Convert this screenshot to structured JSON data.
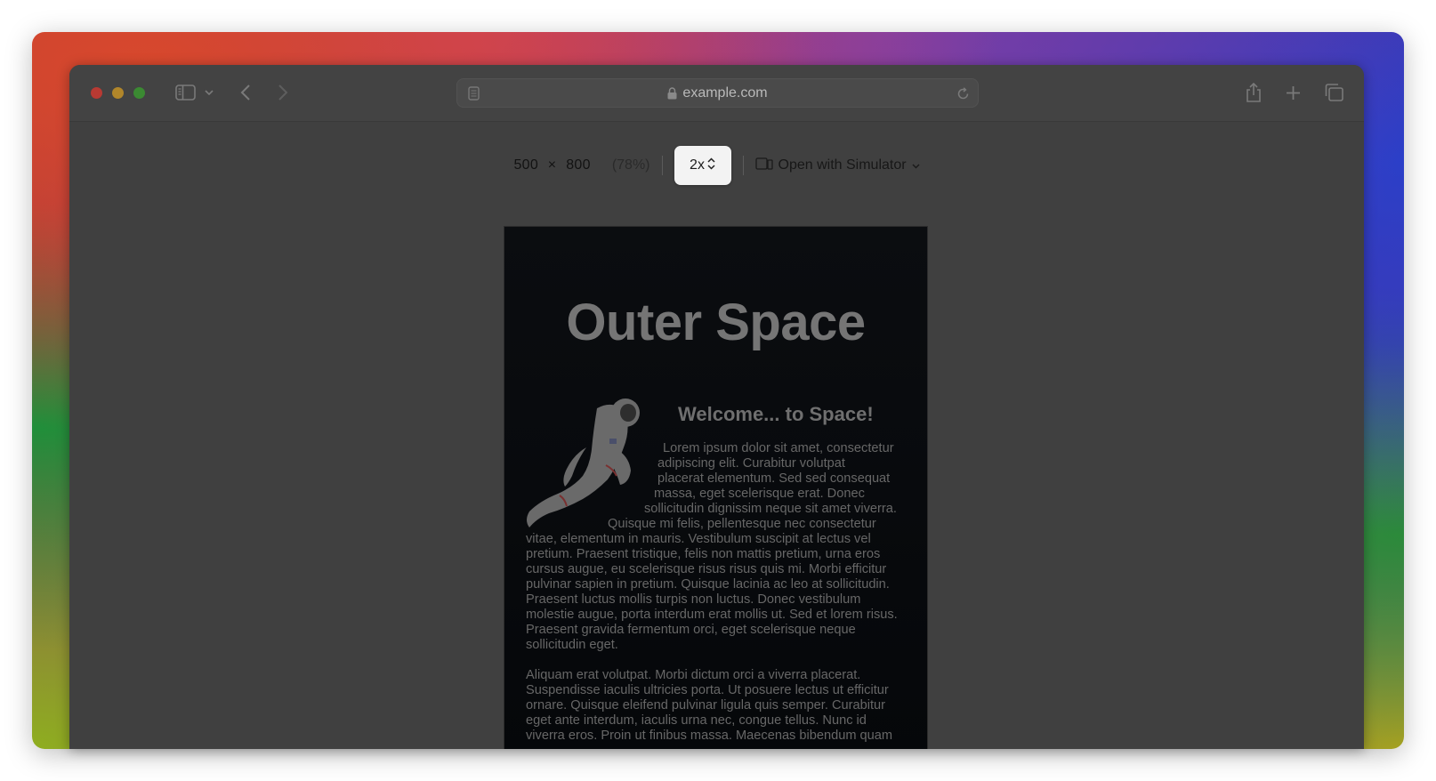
{
  "browser": {
    "url": "example.com",
    "icons": [
      "sidebar-icon",
      "chevron-down-icon",
      "back-icon",
      "forward-icon",
      "reader-icon",
      "lock-icon",
      "reload-icon",
      "share-icon",
      "new-tab-icon",
      "tabs-overview-icon"
    ]
  },
  "responsive_bar": {
    "width": "500",
    "times": "×",
    "height": "800",
    "zoom": "(78%)",
    "scale": "2x",
    "simulator_label": "Open with Simulator"
  },
  "page": {
    "title": "Outer Space",
    "heading": "Welcome... to Space!",
    "para1_lines": [
      "Lorem ipsum dolor sit amet, consectetur",
      "adipiscing elit. Curabitur volutpat",
      "placerat elementum. Sed sed consequat",
      "massa, eget scelerisque erat. Donec",
      "sollicitudin dignissim neque sit amet viverra.",
      "Quisque mi felis, pellentesque nec consectetur",
      "vitae, elementum in mauris. Vestibulum suscipit at lectus vel",
      "pretium. Praesent tristique, felis non mattis pretium, urna eros",
      "cursus augue, eu scelerisque risus risus quis mi. Morbi efficitur",
      "pulvinar sapien in pretium. Quisque lacinia ac leo at sollicitudin.",
      "Praesent luctus mollis turpis non luctus. Donec vestibulum",
      "molestie augue, porta interdum erat mollis ut. Sed et lorem risus.",
      "Praesent gravida fermentum orci, eget scelerisque neque",
      "sollicitudin eget."
    ],
    "para2_lines": [
      "Aliquam erat volutpat. Morbi dictum orci a viverra placerat.",
      "Suspendisse iaculis ultricies porta. Ut posuere lectus ut efficitur",
      "ornare. Quisque eleifend pulvinar ligula quis semper. Curabitur",
      "eget ante interdum, iaculis urna nec, congue tellus. Nunc id",
      "viverra eros. Proin ut finibus massa. Maecenas bibendum quam"
    ]
  }
}
